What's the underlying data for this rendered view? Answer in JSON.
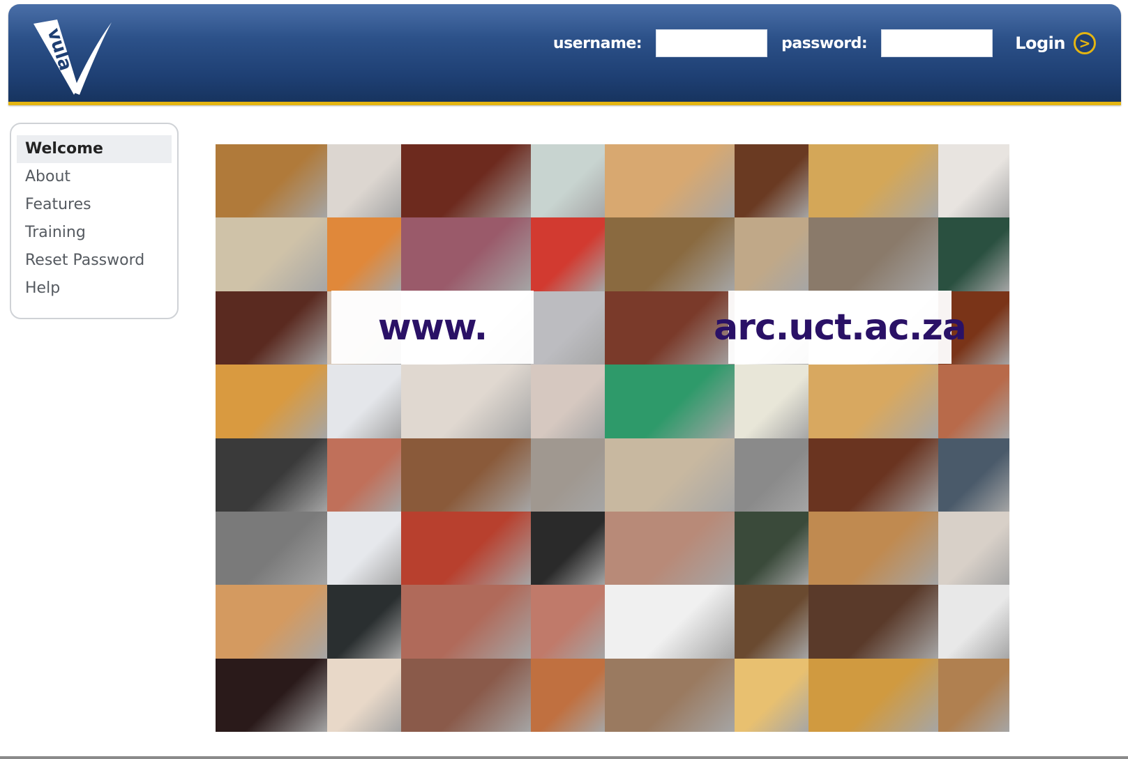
{
  "header": {
    "logo_text": "vula",
    "username_label": "username:",
    "password_label": "password:",
    "username_value": "",
    "password_value": "",
    "login_label": "Login",
    "login_icon": ">",
    "accent_color": "#e4b512",
    "header_color": "#2c5189"
  },
  "nav": {
    "items": [
      {
        "label": "Welcome",
        "active": true
      },
      {
        "label": "About"
      },
      {
        "label": "Features"
      },
      {
        "label": "Training"
      },
      {
        "label": "Reset Password"
      },
      {
        "label": "Help"
      }
    ]
  },
  "collage": {
    "url_part1": "www.",
    "url_part2": "arc.uct.ac.za",
    "url_color": "#2a1166",
    "tile_colors": [
      [
        "#b07a3a",
        "#dcd6d0",
        "#6d2a1e",
        "#c8d4d0",
        "#d8a870",
        "#6a3a22",
        "#d4a758",
        "#e8e4e0"
      ],
      [
        "#cfc2a8",
        "#e0883a",
        "#9a5a6a",
        "#d23a30",
        "#8a6a40",
        "#c0a888",
        "#8a7a6a",
        "#2a5040"
      ],
      [
        "#5a2a20",
        "#d8c8b8",
        "#ffffff",
        "#bcbcc0",
        "#7a3a2a",
        "#ffffff",
        "#ffffff",
        "#7a3418"
      ],
      [
        "#d99a40",
        "#e4e6ea",
        "#e0d8d0",
        "#d6c8c0",
        "#2e9a6a",
        "#e8e6d8",
        "#d8a860",
        "#b86a4a"
      ],
      [
        "#3a3a3a",
        "#c0705a",
        "#8a5a3a",
        "#a09890",
        "#c8b8a0",
        "#8a8a8a",
        "#6a3420",
        "#4a5a6a"
      ],
      [
        "#7a7a7a",
        "#e6e8ec",
        "#b8402e",
        "#2a2a2a",
        "#b88a78",
        "#3a4a3a",
        "#c08a50",
        "#d8d0c8"
      ],
      [
        "#d49a60",
        "#2a2f30",
        "#b06a5a",
        "#c07a6a",
        "#f0f0f0",
        "#6a4a30",
        "#5a3a2a",
        "#e8e8e8"
      ],
      [
        "#2a1a1a",
        "#e8d8c8",
        "#8a5a4a",
        "#c07040",
        "#9a7a60",
        "#e8c070",
        "#d09a40",
        "#b08050"
      ]
    ]
  }
}
